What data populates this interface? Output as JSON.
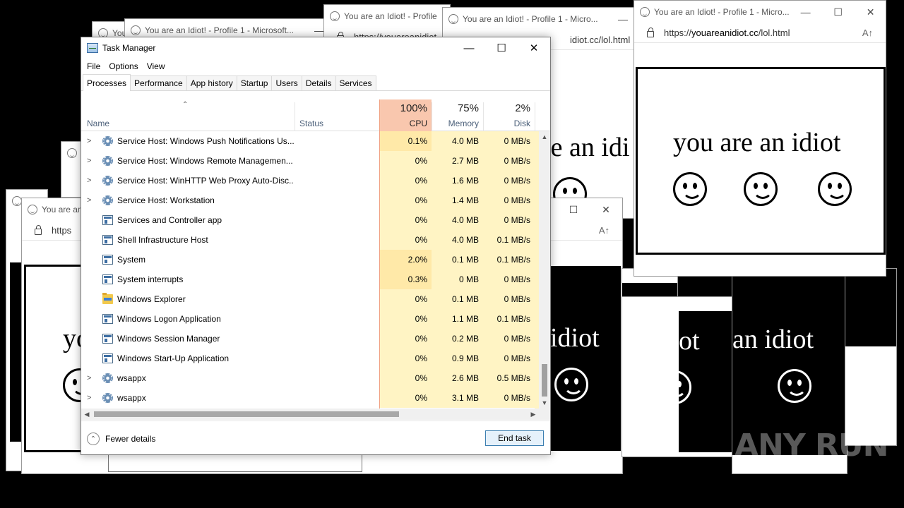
{
  "popups": {
    "title_full": "You are an Idiot! - Profile 1 - Microsoft...",
    "title_short": "You are an Idiot! - Profile 1 - Micro...",
    "title_profile": "You are an Idiot! - Profile",
    "title_cut": "You are an",
    "title_tiny": "You",
    "url_prefix": "https://",
    "url_domain": "youareanidiot.cc",
    "url_path": "/lol.html",
    "url_cut": "https",
    "url_partial": "idiot.cc/lol.html",
    "url_partial_2": "https://youareanidiot",
    "reader_icon": "A↑",
    "message": "you are an idiot",
    "message_cut_1": "re an idi",
    "message_cut_2": "idiot",
    "message_cut_3": "an idiot",
    "message_cut_4": "ot",
    "message_cut_5": "yo",
    "smiley_icon": "smiley-face-icon"
  },
  "task_manager": {
    "title": "Task Manager",
    "menu": [
      "File",
      "Options",
      "View"
    ],
    "tabs": [
      "Processes",
      "Performance",
      "App history",
      "Startup",
      "Users",
      "Details",
      "Services"
    ],
    "active_tab": "Processes",
    "columns": {
      "name": "Name",
      "status": "Status",
      "cpu_label": "CPU",
      "cpu_pct": "100%",
      "mem_label": "Memory",
      "mem_pct": "75%",
      "disk_label": "Disk",
      "disk_pct": "2%"
    },
    "rows": [
      {
        "expand": true,
        "icon": "gear-icon",
        "name": "Service Host: Windows Push Notifications Us...",
        "cpu": "0.1%",
        "memory": "4.0 MB",
        "disk": "0 MB/s"
      },
      {
        "expand": true,
        "icon": "gear-icon",
        "name": "Service Host: Windows Remote Managemen...",
        "cpu": "0%",
        "memory": "2.7 MB",
        "disk": "0 MB/s"
      },
      {
        "expand": true,
        "icon": "gear-icon",
        "name": "Service Host: WinHTTP Web Proxy Auto-Disc...",
        "cpu": "0%",
        "memory": "1.6 MB",
        "disk": "0 MB/s"
      },
      {
        "expand": true,
        "icon": "gear-icon",
        "name": "Service Host: Workstation",
        "cpu": "0%",
        "memory": "1.4 MB",
        "disk": "0 MB/s"
      },
      {
        "expand": false,
        "icon": "window-icon",
        "name": "Services and Controller app",
        "cpu": "0%",
        "memory": "4.0 MB",
        "disk": "0 MB/s"
      },
      {
        "expand": false,
        "icon": "window-icon",
        "name": "Shell Infrastructure Host",
        "cpu": "0%",
        "memory": "4.0 MB",
        "disk": "0.1 MB/s"
      },
      {
        "expand": false,
        "icon": "window-icon",
        "name": "System",
        "cpu": "2.0%",
        "memory": "0.1 MB",
        "disk": "0.1 MB/s"
      },
      {
        "expand": false,
        "icon": "window-icon",
        "name": "System interrupts",
        "cpu": "0.3%",
        "memory": "0 MB",
        "disk": "0 MB/s"
      },
      {
        "expand": false,
        "icon": "folder-icon",
        "name": "Windows Explorer",
        "cpu": "0%",
        "memory": "0.1 MB",
        "disk": "0 MB/s"
      },
      {
        "expand": false,
        "icon": "window-icon",
        "name": "Windows Logon Application",
        "cpu": "0%",
        "memory": "1.1 MB",
        "disk": "0.1 MB/s"
      },
      {
        "expand": false,
        "icon": "window-icon",
        "name": "Windows Session Manager",
        "cpu": "0%",
        "memory": "0.2 MB",
        "disk": "0 MB/s"
      },
      {
        "expand": false,
        "icon": "window-icon",
        "name": "Windows Start-Up Application",
        "cpu": "0%",
        "memory": "0.9 MB",
        "disk": "0 MB/s"
      },
      {
        "expand": true,
        "icon": "gear-icon",
        "name": "wsappx",
        "cpu": "0%",
        "memory": "2.6 MB",
        "disk": "0.5 MB/s"
      },
      {
        "expand": true,
        "icon": "gear-icon",
        "name": "wsappx",
        "cpu": "0%",
        "memory": "3.1 MB",
        "disk": "0 MB/s"
      }
    ],
    "fewer_details": "Fewer details",
    "end_task": "End task"
  },
  "watermark": "ANY RUN",
  "colors": {
    "cpu_header_bg": "#f9c7ae",
    "cell_bg": "#fff4c4",
    "cell_hot_bg": "#ffe9a8",
    "accent": "#3c7fb1"
  }
}
